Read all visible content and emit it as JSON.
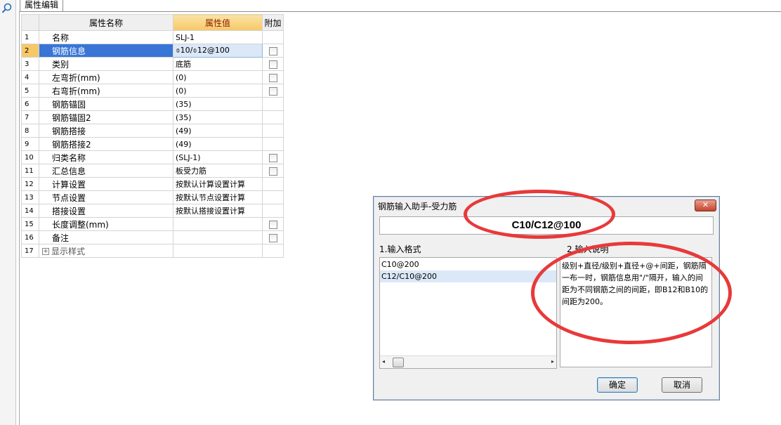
{
  "tab": {
    "label": "属性编辑"
  },
  "grid": {
    "headers": {
      "name": "属性名称",
      "value": "属性值",
      "extra": "附加"
    },
    "rows": [
      {
        "num": "1",
        "name": "名称",
        "value": "SLJ-1",
        "check": false
      },
      {
        "num": "2",
        "name": "钢筋信息",
        "value": "⌽10/⌽12@100",
        "check": true
      },
      {
        "num": "3",
        "name": "类别",
        "value": "底筋",
        "check": true
      },
      {
        "num": "4",
        "name": "左弯折(mm)",
        "value": "(0)",
        "check": true
      },
      {
        "num": "5",
        "name": "右弯折(mm)",
        "value": "(0)",
        "check": true
      },
      {
        "num": "6",
        "name": "钢筋锚固",
        "value": "(35)",
        "check": false
      },
      {
        "num": "7",
        "name": "钢筋锚固2",
        "value": "(35)",
        "check": false
      },
      {
        "num": "8",
        "name": "钢筋搭接",
        "value": "(49)",
        "check": false
      },
      {
        "num": "9",
        "name": "钢筋搭接2",
        "value": "(49)",
        "check": false
      },
      {
        "num": "10",
        "name": "归类名称",
        "value": "(SLJ-1)",
        "check": true
      },
      {
        "num": "11",
        "name": "汇总信息",
        "value": "板受力筋",
        "check": true
      },
      {
        "num": "12",
        "name": "计算设置",
        "value": "按默认计算设置计算",
        "check": false
      },
      {
        "num": "13",
        "name": "节点设置",
        "value": "按默认节点设置计算",
        "check": false
      },
      {
        "num": "14",
        "name": "搭接设置",
        "value": "按默认搭接设置计算",
        "check": false
      },
      {
        "num": "15",
        "name": "长度调整(mm)",
        "value": "",
        "check": true
      },
      {
        "num": "16",
        "name": "备注",
        "value": "",
        "check": true
      },
      {
        "num": "17",
        "name": "显示样式",
        "value": "",
        "check": false
      }
    ],
    "expand_symbol": "+"
  },
  "dialog": {
    "title": "钢筋输入助手-受力筋",
    "close_symbol": "✕",
    "input_value": "C10/C12@100",
    "section1_label": "1.输入格式",
    "section2_label": "2.输入说明",
    "formats": [
      "C10@200",
      "C12/C10@200"
    ],
    "description": "级别+直径/级别+直径+@+间距，钢筋隔一布一时，钢筋信息用\"/\"隔开，输入的间距为不同钢筋之间的间距，即B12和B10的间距为200。",
    "ok_label": "确定",
    "cancel_label": "取消",
    "scroll_left": "◂",
    "scroll_right": "▸"
  },
  "colors": {
    "annotation": "#e8393a",
    "selection": "#3875d7",
    "header_highlight": "#f6c867"
  }
}
